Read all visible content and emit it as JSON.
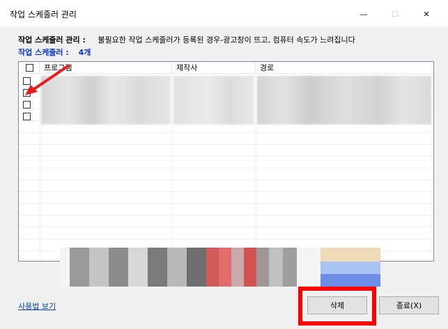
{
  "window": {
    "title": "작업 스케줄러 관리",
    "controls": {
      "minimize": "—",
      "maximize": "☐",
      "close": "✕"
    }
  },
  "info": {
    "label": "작업 스케줄러 관리 :",
    "description": "불필요한 작업 스케줄러가 등록된 경우-광고창이 뜨고, 컴퓨터 속도가 느려집니다",
    "count_label": "작업 스케줄러 :",
    "count_value": "4개"
  },
  "list": {
    "columns": [
      "프로그램",
      "제작사",
      "경로"
    ],
    "row_count": 4
  },
  "footer": {
    "view_link": "사용법 보기",
    "delete_button": "삭제",
    "close_button": "종료(X)"
  },
  "colors": {
    "highlight": "#ff0000",
    "count_text": "#0a36d4",
    "link": "#0645ad"
  }
}
